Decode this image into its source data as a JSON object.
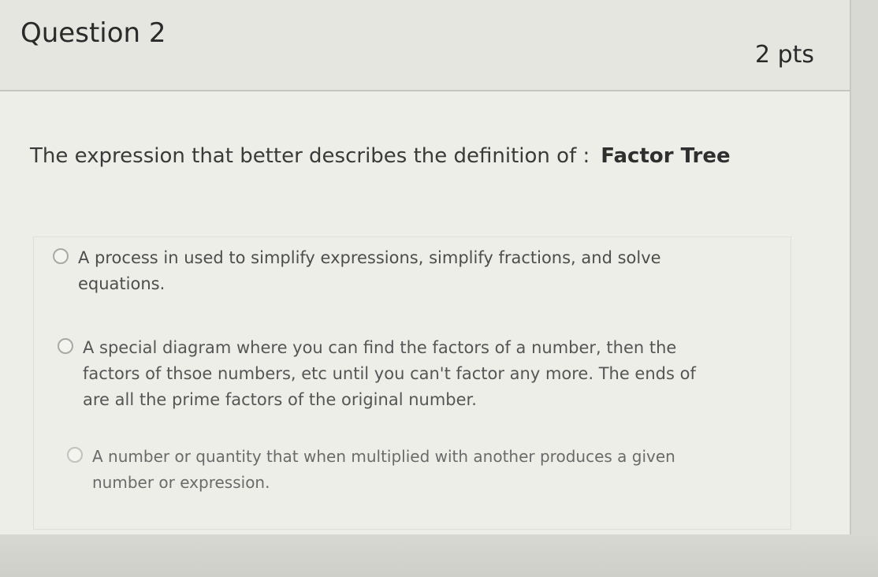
{
  "question": {
    "title": "Question 2",
    "points": "2 pts",
    "prompt": "The expression that better describes the definition of :",
    "term": "Factor Tree"
  },
  "answers": [
    {
      "text": "A process in used to simplify expressions, simplify fractions, and solve\nequations."
    },
    {
      "text": "A special diagram where you can find the factors of a number, then the\nfactors of thsoe numbers, etc until you can't factor any more.  The ends of\nare all the prime factors of the original number."
    },
    {
      "text": "A number or quantity that when multiplied with another produces a given\nnumber or expression."
    }
  ]
}
